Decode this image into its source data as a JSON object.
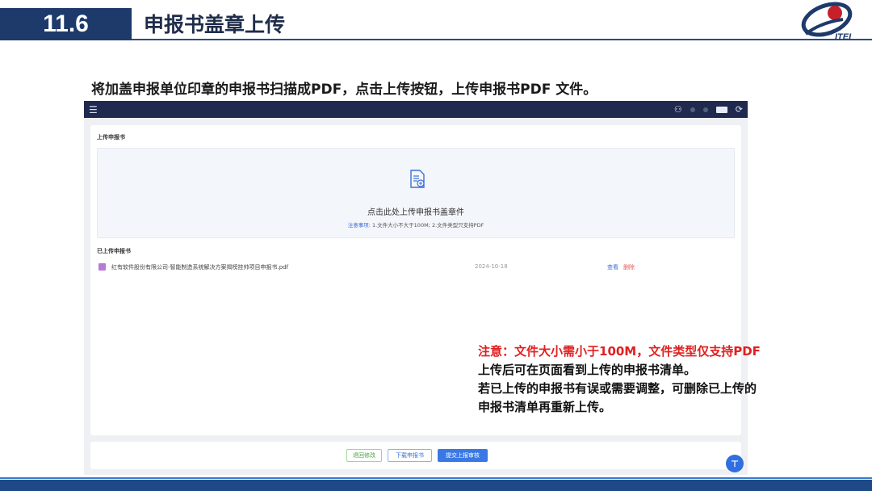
{
  "slide": {
    "section_number": "11.6",
    "section_title": "申报书盖章上传",
    "logo_text": "ITEI",
    "intro": "将加盖申报单位印章的申报书扫描成PDF，点击上传按钮，上传申报书PDF 文件。"
  },
  "app": {
    "upload_section_title": "上传申报书",
    "dropzone": {
      "prompt": "点击此处上传申报书盖章件",
      "note_label": "注意事项:",
      "note_text": "1.文件大小不大于100M; 2.文件类型只支持PDF"
    },
    "uploaded_section_title": "已上传申报书",
    "files": [
      {
        "name": "红有软件股份有限公司-智能制造系统解决方案揭榜挂帅项目申报书.pdf",
        "date": "2024-10-18",
        "view_label": "查看",
        "delete_label": "删除"
      }
    ],
    "buttons": {
      "back": "退回修改",
      "download": "下载申报书",
      "submit": "提交上报审核"
    },
    "fab_label": "⊤"
  },
  "notes": {
    "warning": "注意：文件大小需小于100M，文件类型仅支持PDF",
    "line1": "上传后可在页面看到上传的申报书清单。",
    "line2": "若已上传的申报书有误或需要调整，可删除已上传的",
    "line3": "申报书清单再重新上传。"
  },
  "colors": {
    "header_navy": "#1d3a6b",
    "topbar": "#202a4f",
    "link_blue": "#3b6fd8",
    "warning_red": "#e02020",
    "delete_red": "#e05a5a",
    "back_green": "#4aa33f"
  },
  "icons": [
    "menu-icon",
    "user-icon",
    "logout-icon",
    "document-upload-icon",
    "pdf-file-icon",
    "back-to-top-icon"
  ]
}
